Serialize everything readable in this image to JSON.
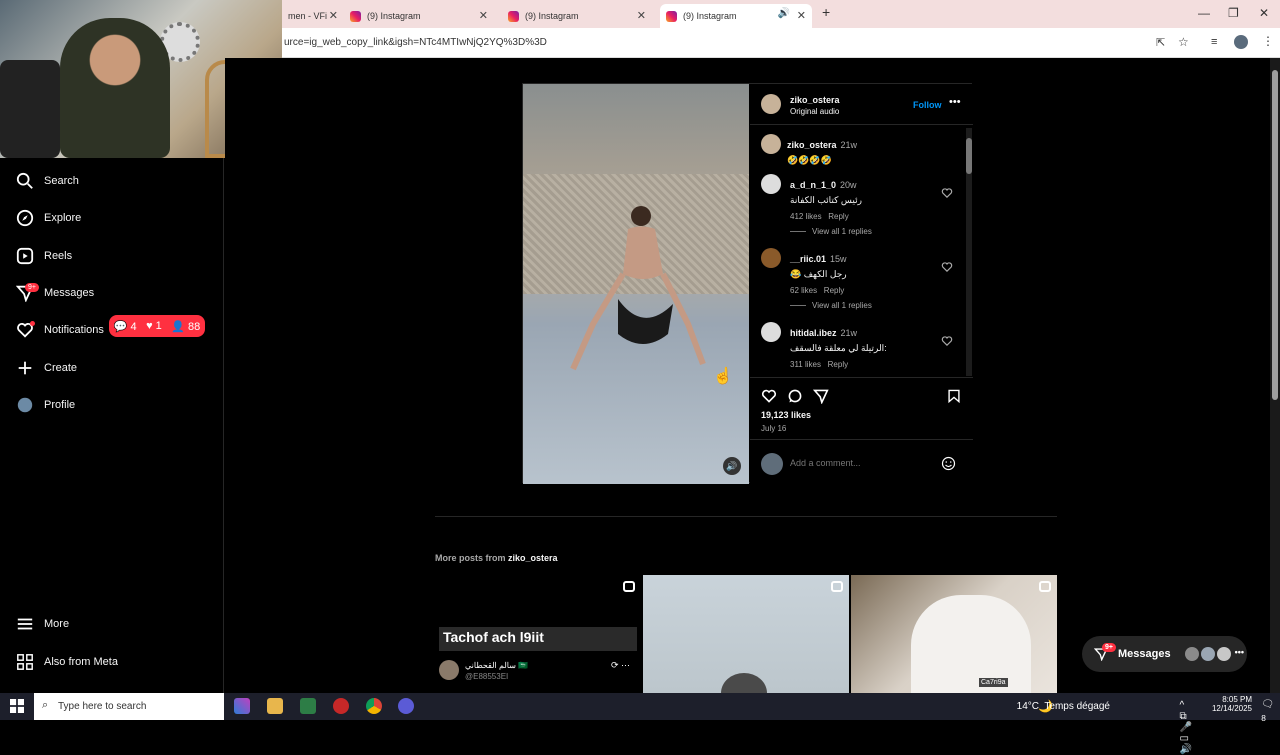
{
  "browser": {
    "tabs": [
      {
        "title": "men - VFi"
      },
      {
        "title": "(9) Instagram"
      },
      {
        "title": "(9) Instagram"
      },
      {
        "title": "(9) Instagram"
      }
    ],
    "new_tab_glyph": "+",
    "url": "urce=ig_web_copy_link&igsh=NTc4MTIwNjQ2YQ%3D%3D"
  },
  "sidebar": {
    "items": [
      {
        "label": "Search",
        "icon": "search-icon"
      },
      {
        "label": "Explore",
        "icon": "compass-icon"
      },
      {
        "label": "Reels",
        "icon": "reels-icon"
      },
      {
        "label": "Messages",
        "icon": "messenger-icon",
        "badge": "9+"
      },
      {
        "label": "Notifications",
        "icon": "heart-icon"
      },
      {
        "label": "Create",
        "icon": "plus-icon"
      },
      {
        "label": "Profile",
        "icon": "avatar"
      }
    ],
    "more": "More",
    "also_from_meta": "Also from Meta",
    "notifications_pill": {
      "comments": "4",
      "likes": "1",
      "follows": "88"
    }
  },
  "post": {
    "username": "ziko_ostera",
    "audio": "Original audio",
    "follow_label": "Follow",
    "comments": [
      {
        "user": "ziko_ostera",
        "time": "21w",
        "text": "🤣🤣🤣🤣"
      },
      {
        "user": "a_d_n_1_0",
        "time": "20w",
        "text": "رئيس كتائب الكفانة",
        "likes": "412 likes",
        "reply": "Reply",
        "view_replies": "View all 1 replies"
      },
      {
        "user": "__riic.01",
        "time": "15w",
        "text": "😂 رجل الكهف",
        "likes": "62 likes",
        "reply": "Reply",
        "view_replies": "View all 1 replies"
      },
      {
        "user": "hitidal.ibez",
        "time": "21w",
        "text": "الرتيلة لي معلقة فالسقف:",
        "likes": "311 likes",
        "reply": "Reply"
      }
    ],
    "likes": "19,123 likes",
    "date": "July 16",
    "add_comment_placeholder": "Add a comment..."
  },
  "more_posts": {
    "prefix": "More posts from",
    "user": "ziko_ostera",
    "thumb1_caption": "Tachof ach l9iit",
    "thumb1_name": "سالم القحطاني 🇸🇦",
    "thumb1_handle": "@E88553EI",
    "thumb3_caption": "Ca7ri9a"
  },
  "floating_messages": {
    "label": "Messages",
    "badge": "9+"
  },
  "taskbar": {
    "search_placeholder": "Type here to search",
    "weather": "14°C  Temps dégagé",
    "time": "8:05 PM",
    "date": "12/14/2025",
    "notif_count": "8"
  },
  "colors": {
    "accent": "#0095f6",
    "notif_red": "#ff3040",
    "bg": "#000000"
  }
}
